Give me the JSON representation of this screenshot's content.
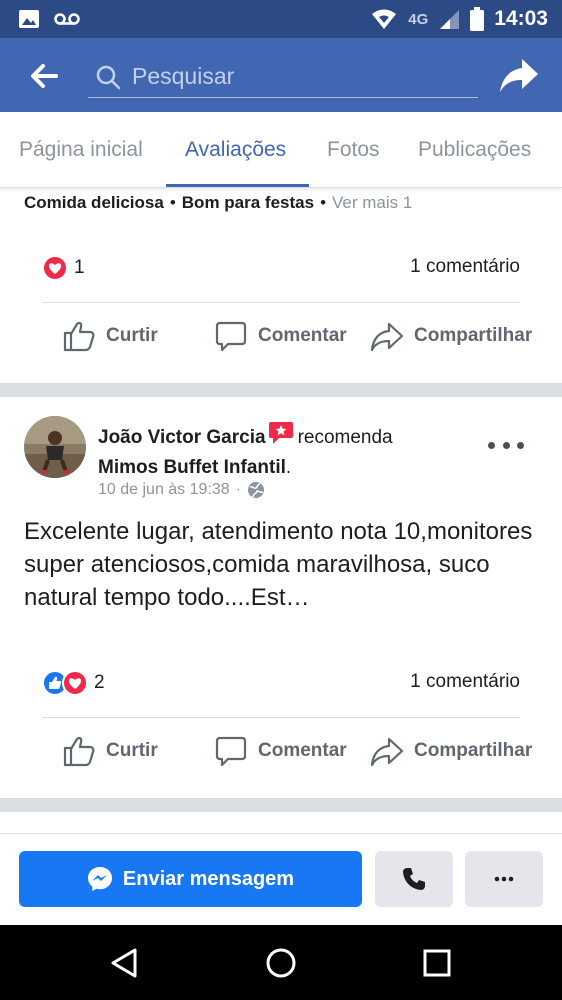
{
  "status_bar": {
    "network": "4G",
    "time": "14:03"
  },
  "header": {
    "search_placeholder": "Pesquisar"
  },
  "tabs": [
    {
      "label": "Página inicial",
      "active": false
    },
    {
      "label": "Avaliações",
      "active": true
    },
    {
      "label": "Fotos",
      "active": false
    },
    {
      "label": "Publicações",
      "active": false
    }
  ],
  "prev_post": {
    "tag_1": "Comida deliciosa",
    "tag_2": "Bom para festas",
    "separator": "•",
    "see_more": "Ver mais 1",
    "reaction_count": "1",
    "comments": "1 comentário"
  },
  "actions": {
    "like": "Curtir",
    "comment": "Comentar",
    "share": "Compartilhar"
  },
  "post": {
    "author": "João Victor Garcia",
    "verb": "recomenda",
    "page_name": "Mimos Buffet Infantil",
    "period": ".",
    "timestamp": "10 de jun às 19:38",
    "meta_separator": "·",
    "body": "Excelente lugar, atendimento nota 10,monitores super atenciosos,comida maravilhosa, suco natural tempo todo....Est…",
    "reaction_count": "2",
    "comments": "1 comentário"
  },
  "bottom_bar": {
    "message_button": "Enviar mensagem"
  },
  "colors": {
    "header_blue": "#4267b2",
    "status_blue": "#2c4a85",
    "messenger_blue": "#1877f2",
    "heart_red": "#f0284a"
  },
  "icons": {
    "back": "arrow-left-icon",
    "search": "search-icon",
    "share": "share-arrow-icon",
    "like": "thumbs-up-icon",
    "comment": "speech-bubble-icon",
    "share_action": "share-outline-icon",
    "recommend": "recommend-badge-icon",
    "privacy": "globe-icon",
    "messenger": "messenger-icon",
    "phone": "phone-icon",
    "more": "more-dots-icon"
  }
}
